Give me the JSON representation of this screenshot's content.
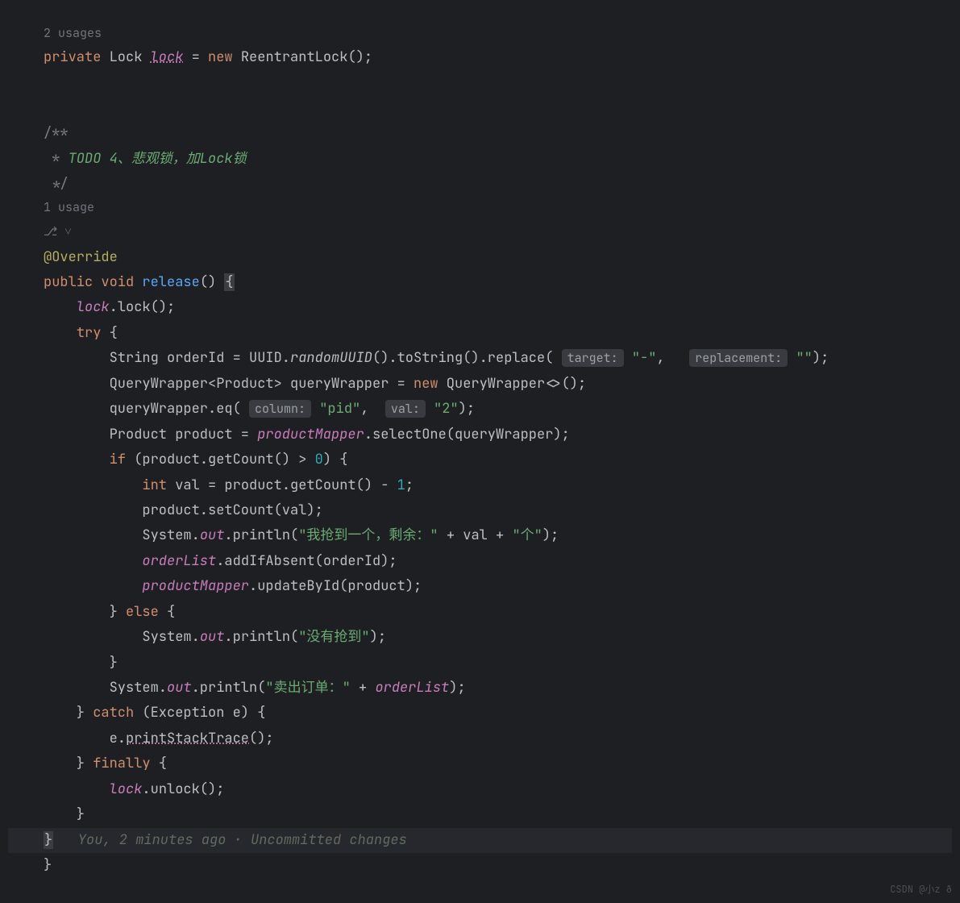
{
  "hints": {
    "usages2": "2 usages",
    "usage1": "1 usage"
  },
  "gutter": {
    "icon": "⎇ ˅"
  },
  "code": {
    "l1": {
      "kw_private": "private",
      "t_Lock": " Lock ",
      "f_lock": "lock",
      "eq": " = ",
      "kw_new": "new",
      "rest": " ReentrantLock();"
    },
    "c1": "/**",
    "c2_a": " * ",
    "c2_b": "TODO 4、悲观锁，加Lock锁",
    "c3": " */",
    "anno": "@Override",
    "l_sig": {
      "kw_public": "public",
      "kw_void": " void ",
      "name": "release",
      "rest": "() ",
      "brace": "{"
    },
    "l_lock": {
      "i": "    ",
      "f": "lock",
      "rest": ".lock();"
    },
    "l_try": {
      "i": "    ",
      "kw": "try",
      "rest": " {"
    },
    "l_uuid": {
      "i": "        String orderId = UUID.",
      "m": "randomUUID",
      "mid": "().toString().replace(",
      "h1": "target:",
      "s1": " \"-\"",
      "comma": ",  ",
      "h2": "replacement:",
      "s2": " \"\"",
      "end": ");"
    },
    "l_qw": {
      "i": "        QueryWrapper<Product> queryWrapper = ",
      "kw_new": "new",
      "rest": " QueryWrapper<>();"
    },
    "l_eq": {
      "i": "        queryWrapper.eq( ",
      "h1": "column:",
      "s1": " \"pid\"",
      "comma": ",  ",
      "h2": "val:",
      "s2": " \"2\"",
      "end": ");"
    },
    "l_sel": {
      "i": "        Product product = ",
      "f": "productMapper",
      "rest": ".selectOne(queryWrapper);"
    },
    "l_if": {
      "i": "        ",
      "kw_if": "if",
      "mid": " (product.getCount() > ",
      "n": "0",
      "end": ") {"
    },
    "l_val": {
      "i": "            ",
      "kw_int": "int",
      "mid": " val = product.getCount() - ",
      "n": "1",
      "end": ";"
    },
    "l_set": "            product.setCount(val);",
    "l_p1": {
      "i": "            System.",
      "out": "out",
      "mid": ".println(",
      "s": "\"我抢到一个，剩余：\"",
      "plus": " + val + ",
      "s2": "\"个\"",
      "end": ");"
    },
    "l_add": {
      "i": "            ",
      "f": "orderList",
      "rest": ".addIfAbsent(orderId);"
    },
    "l_upd": {
      "i": "            ",
      "f": "productMapper",
      "rest": ".updateById(product);"
    },
    "l_else": {
      "i": "        } ",
      "kw": "else",
      "rest": " {"
    },
    "l_p2": {
      "i": "            System.",
      "out": "out",
      "mid": ".println(",
      "s": "\"没有抢到\"",
      "end": ");"
    },
    "l_cb1": "        }",
    "l_p3": {
      "i": "        System.",
      "out": "out",
      "mid": ".println(",
      "s": "\"卖出订单：\"",
      "plus": " + ",
      "f": "orderList",
      "end": ");"
    },
    "l_catch": {
      "i": "    } ",
      "kw": "catch",
      "rest": " (Exception e) {"
    },
    "l_pst": {
      "i": "        e.",
      "m": "printStackTrace",
      "end": "();"
    },
    "l_fin": {
      "i": "    } ",
      "kw": "finally",
      "rest": " {"
    },
    "l_unlock": {
      "i": "        ",
      "f": "lock",
      "rest": ".unlock();"
    },
    "l_cb2": "    }",
    "l_last": {
      "brace": "}",
      "ann": "   You, 2 minutes ago · Uncommitted changes"
    },
    "l_end": "}"
  },
  "watermark": "CSDN @小z ð"
}
